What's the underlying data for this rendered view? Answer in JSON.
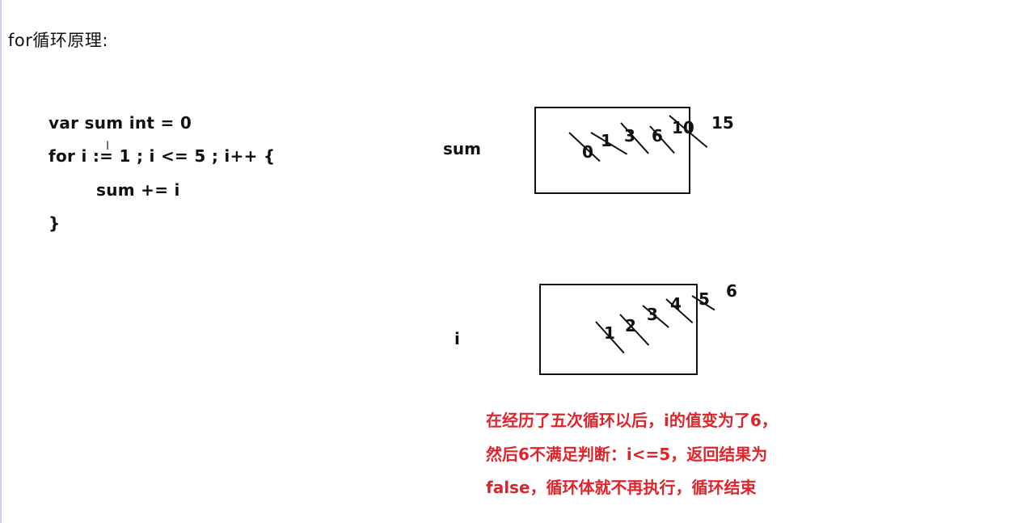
{
  "heading": "for循环原理:",
  "code": {
    "line1": "var sum int = 0",
    "line2": "for i := 1 ; i <= 5 ; i++ {",
    "line3": "sum += i",
    "line4": "}"
  },
  "cursor_glyph": "I",
  "diagram": {
    "sum_label": "sum",
    "sum_values": [
      "0",
      "1",
      "3",
      "6",
      "10"
    ],
    "sum_final": "15",
    "i_label": "i",
    "i_values": [
      "1",
      "2",
      "3",
      "4",
      "5"
    ],
    "i_final": "6"
  },
  "note": {
    "line1": "在经历了五次循环以后，i的值变为了6，",
    "line2": "然后6不满足判断：i<=5，返回结果为",
    "line3": "false，循环体就不再执行，循环结束"
  }
}
